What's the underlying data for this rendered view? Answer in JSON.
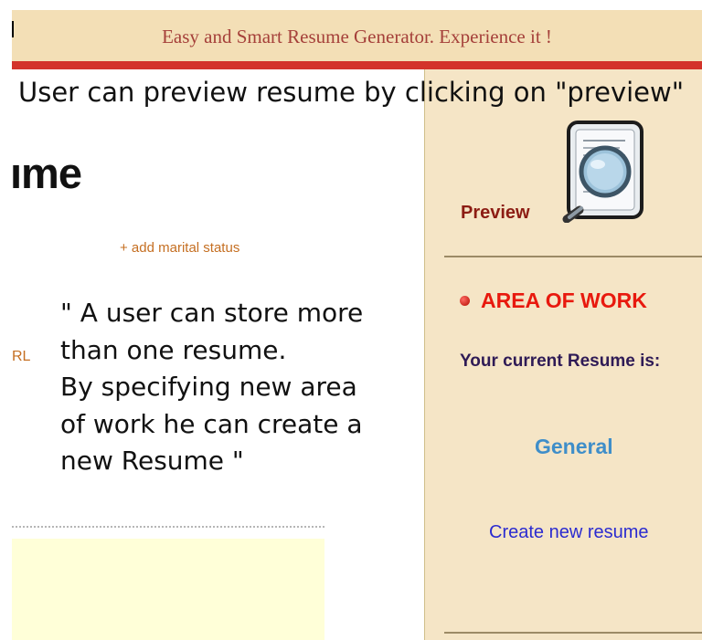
{
  "banner": {
    "text": "Easy and Smart Resume Generator.   Experience it !"
  },
  "caption": "User can preview resume by clicking on \"preview\"",
  "left": {
    "heading": "ıme",
    "add_marital": "+ add marital status",
    "url_label": "RL",
    "annotation_lines": [
      "\" A user can store more",
      "than one resume.",
      "By specifying new area",
      "of work he can create a",
      "new Resume \""
    ]
  },
  "right": {
    "preview_label": "Preview",
    "preview_icon": "document-magnifier-icon",
    "area_title": "AREA OF WORK",
    "current_label": "Your current Resume is:",
    "current_resume": "General",
    "create_new": "Create new resume"
  },
  "colors": {
    "banner_bg": "#f3dfb6",
    "banner_text": "#a5403a",
    "banner_bar": "#d3332a",
    "panel_bg": "#f5e5c6",
    "area_title": "#e8190e",
    "resume_name": "#3f8ec9",
    "link": "#2b2bd0"
  }
}
